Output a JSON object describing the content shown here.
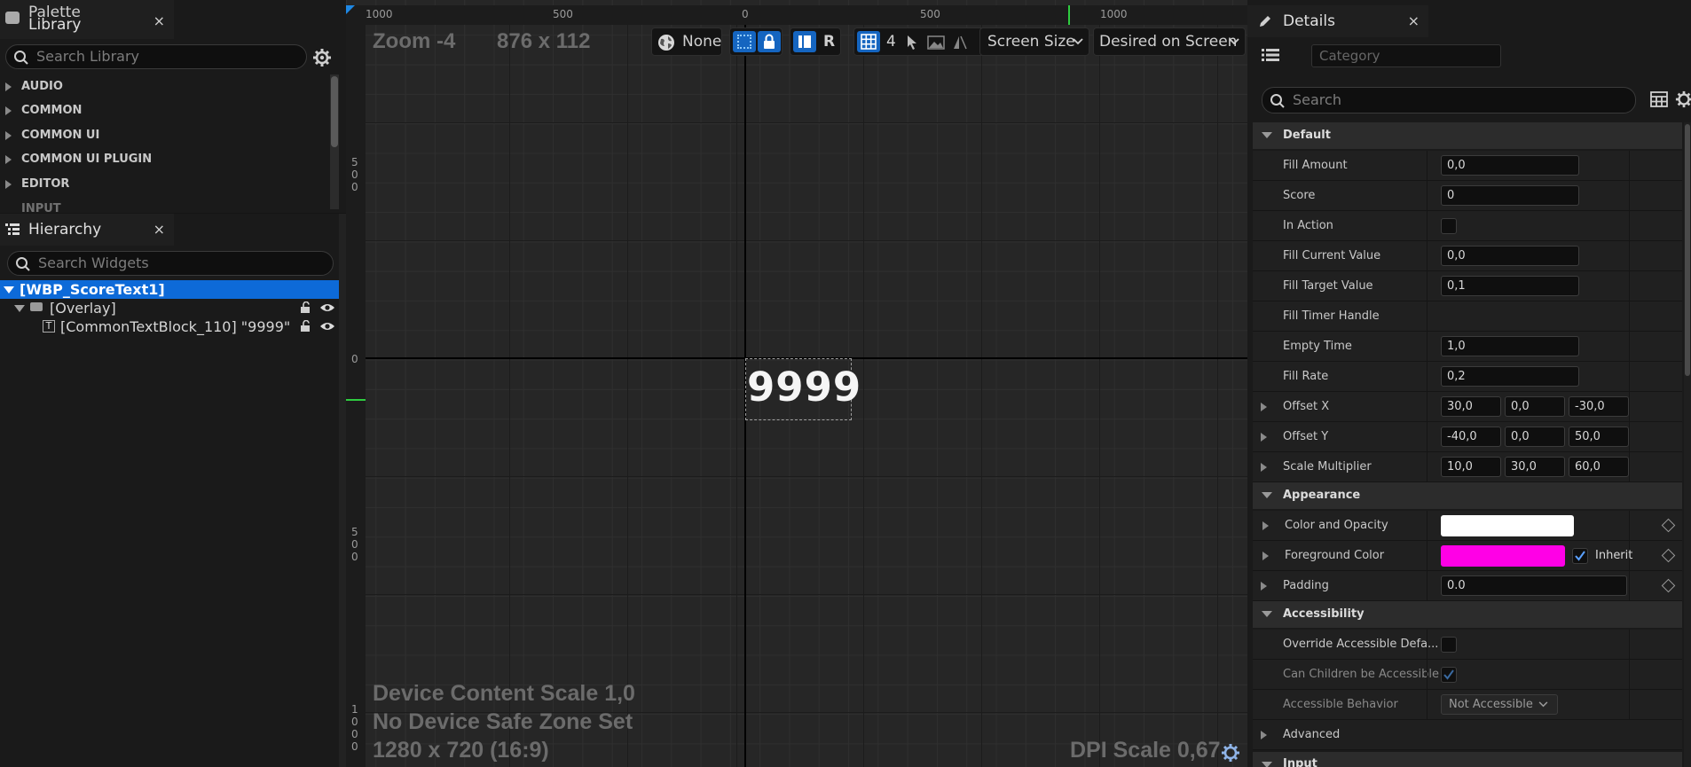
{
  "palette": {
    "tab_label": "Palette",
    "library_label": "Library",
    "close": "×",
    "search_placeholder": "Search Library",
    "categories": [
      "AUDIO",
      "COMMON",
      "COMMON UI",
      "COMMON UI PLUGIN",
      "EDITOR",
      "INPUT"
    ]
  },
  "hierarchy": {
    "tab_label": "Hierarchy",
    "close": "×",
    "search_placeholder": "Search Widgets",
    "items": [
      {
        "label": "[WBP_ScoreText1]"
      },
      {
        "label": "[Overlay]"
      },
      {
        "label": "[CommonTextBlock_110] \"9999\""
      }
    ]
  },
  "viewport": {
    "ruler_top": [
      "1000",
      "500",
      "0",
      "500",
      "1000"
    ],
    "ruler_left": [
      "5",
      "0",
      "0",
      "0",
      "5",
      "0",
      "0",
      "1",
      "0",
      "0",
      "0"
    ],
    "zoom": "Zoom -4",
    "size": "876 x 112",
    "toolbar": {
      "none_label": "None",
      "r_label": "R",
      "grid_value": "4",
      "screen_size_label": "Screen Size",
      "desired_label": "Desired on Screen"
    },
    "widget_text": "9999",
    "device_scale": "Device Content Scale 1,0",
    "safe_zone": "No Device Safe Zone Set",
    "resolution": "1280 x 720 (16:9)",
    "dpi_scale": "DPI Scale 0,67"
  },
  "details": {
    "tab_label": "Details",
    "close": "×",
    "category_placeholder": "Category",
    "search_placeholder": "Search",
    "sections": {
      "default": "Default",
      "appearance": "Appearance",
      "accessibility": "Accessibility",
      "advanced": "Advanced",
      "input": "Input"
    },
    "props": {
      "fill_amount": {
        "label": "Fill Amount",
        "value": "0,0"
      },
      "score": {
        "label": "Score",
        "value": "0"
      },
      "in_action": {
        "label": "In Action"
      },
      "fill_current": {
        "label": "Fill Current Value",
        "value": "0,0"
      },
      "fill_target": {
        "label": "Fill Target Value",
        "value": "0,1"
      },
      "fill_timer": {
        "label": "Fill Timer Handle"
      },
      "empty_time": {
        "label": "Empty Time",
        "value": "1,0"
      },
      "fill_rate": {
        "label": "Fill Rate",
        "value": "0,2"
      },
      "offset_x": {
        "label": "Offset X",
        "values": [
          "30,0",
          "0,0",
          "-30,0"
        ]
      },
      "offset_y": {
        "label": "Offset Y",
        "values": [
          "-40,0",
          "0,0",
          "50,0"
        ]
      },
      "scale_mult": {
        "label": "Scale Multiplier",
        "values": [
          "10,0",
          "30,0",
          "60,0"
        ]
      },
      "color_opacity": {
        "label": "Color and Opacity"
      },
      "foreground": {
        "label": "Foreground Color",
        "inherit": "Inherit"
      },
      "padding": {
        "label": "Padding",
        "value": "0.0"
      },
      "override_access": {
        "label": "Override Accessible Defa..."
      },
      "children_access": {
        "label": "Can Children be Accessible"
      },
      "access_behavior": {
        "label": "Accessible Behavior",
        "value": "Not Accessible"
      }
    }
  },
  "colors": {
    "accent": "#0d6ad8",
    "color_opacity_swatch": "#ffffff",
    "foreground_swatch": "#ff00e6"
  }
}
